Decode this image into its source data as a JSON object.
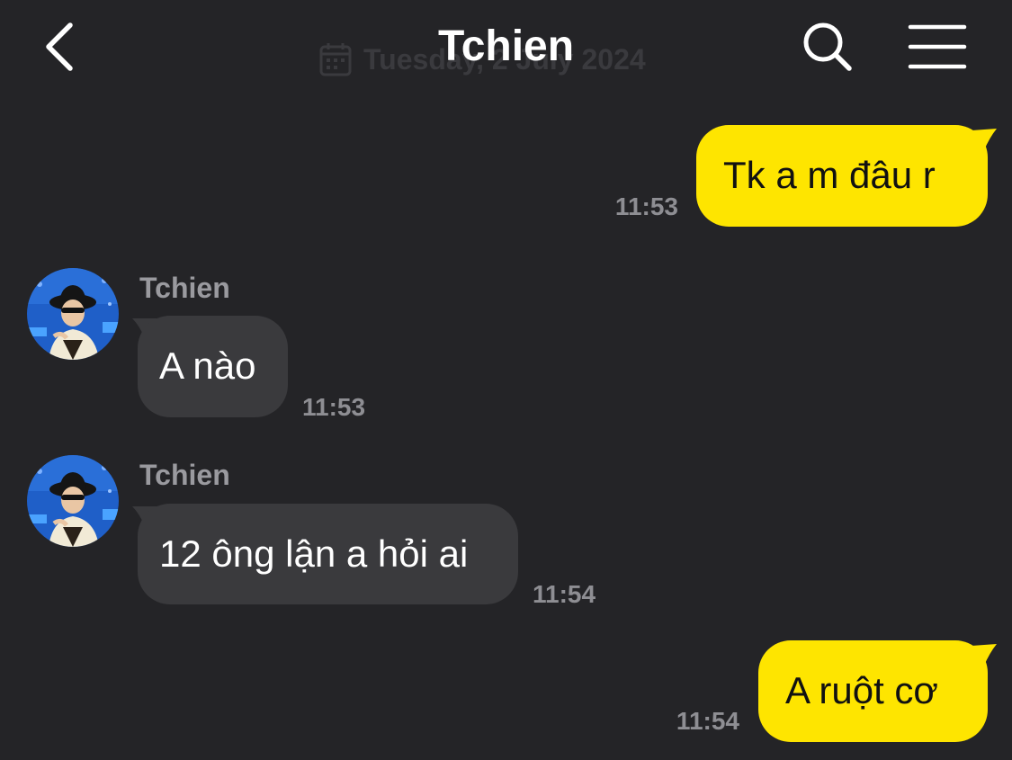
{
  "header": {
    "title": "Tchien",
    "date_label": "Tuesday, 2 July 2024",
    "back_icon": "chevron-left-icon",
    "search_icon": "search-icon",
    "menu_icon": "hamburger-menu-icon"
  },
  "colors": {
    "background": "#242427",
    "outgoing_bubble": "#fee500",
    "incoming_bubble": "#3a3a3d",
    "timestamp": "#8e8e93"
  },
  "messages": [
    {
      "direction": "outgoing",
      "text": "Tk a m đâu r",
      "time": "11:53"
    },
    {
      "direction": "incoming",
      "sender": "Tchien",
      "text": "A nào",
      "time": "11:53"
    },
    {
      "direction": "incoming",
      "sender": "Tchien",
      "text": "12 ông lận a hỏi ai",
      "time": "11:54"
    },
    {
      "direction": "outgoing",
      "text": "A ruột cơ",
      "time": "11:54"
    }
  ]
}
